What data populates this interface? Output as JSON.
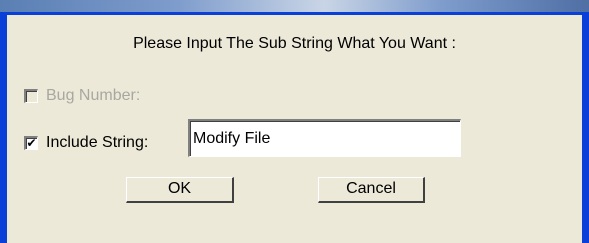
{
  "dialog": {
    "prompt": "Please Input The Sub String What You Want :",
    "bug_number": {
      "label": "Bug Number:",
      "checked": false,
      "enabled": false
    },
    "include_string": {
      "label": "Include String:",
      "checked": true,
      "value": "Modify File",
      "check_glyph": "✔"
    },
    "ok_label": "OK",
    "cancel_label": "Cancel"
  },
  "colors": {
    "frame": "#0a3fd8",
    "dialog_bg": "#ece9d8",
    "disabled_text": "#a8a8a0"
  }
}
